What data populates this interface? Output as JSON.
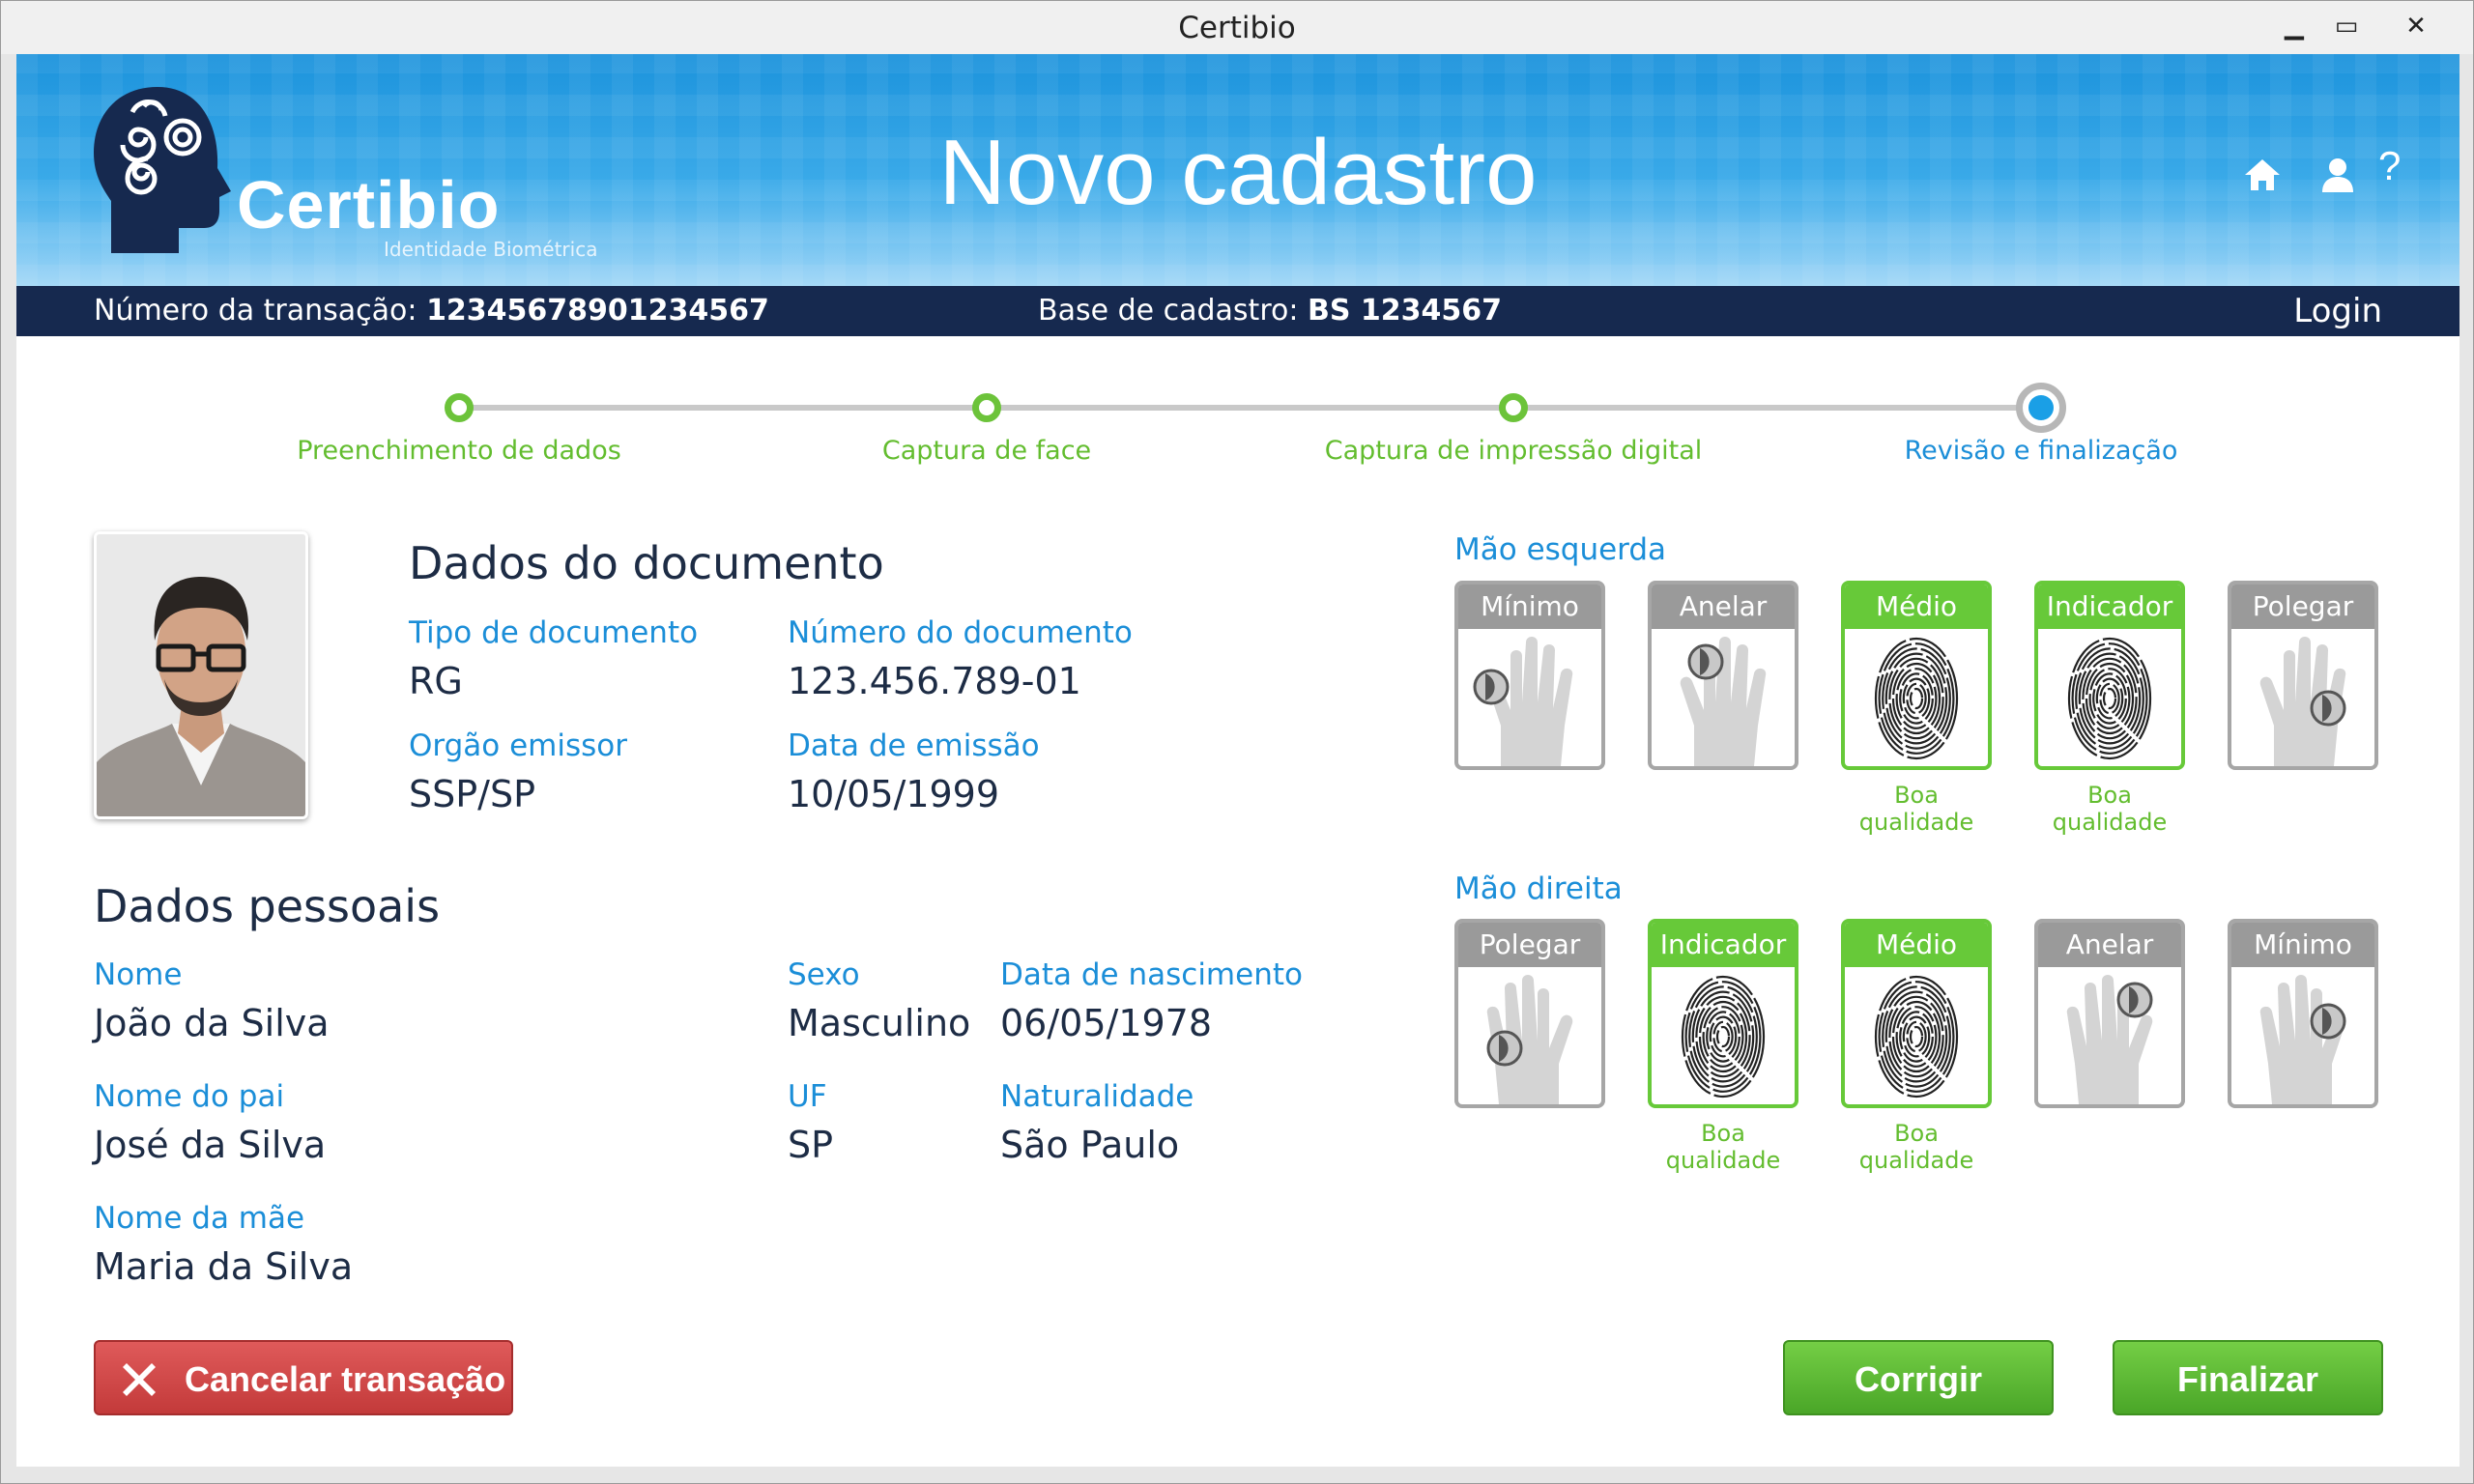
{
  "window": {
    "title": "Certibio",
    "controls": {
      "minimize": "▁",
      "maximize": "▭",
      "close": "✕"
    }
  },
  "header": {
    "brand_name": "Certibio",
    "brand_subtitle": "Identidade Biométrica",
    "page_title": "Novo cadastro",
    "icons": [
      "home-icon",
      "user-icon",
      "help-icon"
    ],
    "help_glyph": "?"
  },
  "infobar": {
    "transaction_label": "Número da transação:",
    "transaction_value": "12345678901234567",
    "base_label": "Base de cadastro:",
    "base_value": "BS 1234567",
    "login": "Login"
  },
  "steps": [
    {
      "label": "Preenchimento de dados",
      "state": "complete"
    },
    {
      "label": "Captura de face",
      "state": "complete"
    },
    {
      "label": "Captura de impressão digital",
      "state": "complete"
    },
    {
      "label": "Revisão e finalização",
      "state": "current"
    }
  ],
  "document": {
    "heading": "Dados do documento",
    "type_label": "Tipo de documento",
    "type_value": "RG",
    "number_label": "Número do documento",
    "number_value": "123.456.789-01",
    "issuer_label": "Orgão emissor",
    "issuer_value": "SSP/SP",
    "date_label": "Data de emissão",
    "date_value": "10/05/1999"
  },
  "personal": {
    "heading": "Dados pessoais",
    "name_label": "Nome",
    "name_value": "João da Silva",
    "sex_label": "Sexo",
    "sex_value": "Masculino",
    "birth_label": "Data de nascimento",
    "birth_value": "06/05/1978",
    "father_label": "Nome do pai",
    "father_value": "José da Silva",
    "uf_label": "UF",
    "uf_value": "SP",
    "birthplace_label": "Naturalidade",
    "birthplace_value": "São Paulo",
    "mother_label": "Nome da mãe",
    "mother_value": "Maria da Silva"
  },
  "left_hand": {
    "title": "Mão esquerda",
    "fingers": [
      {
        "name": "Mínimo",
        "captured": false,
        "quality": ""
      },
      {
        "name": "Anelar",
        "captured": false,
        "quality": ""
      },
      {
        "name": "Médio",
        "captured": true,
        "quality": "Boa qualidade"
      },
      {
        "name": "Indicador",
        "captured": true,
        "quality": "Boa qualidade"
      },
      {
        "name": "Polegar",
        "captured": false,
        "quality": ""
      }
    ]
  },
  "right_hand": {
    "title": "Mão direita",
    "fingers": [
      {
        "name": "Polegar",
        "captured": false,
        "quality": ""
      },
      {
        "name": "Indicador",
        "captured": true,
        "quality": "Boa qualidade"
      },
      {
        "name": "Médio",
        "captured": true,
        "quality": "Boa qualidade"
      },
      {
        "name": "Anelar",
        "captured": false,
        "quality": ""
      },
      {
        "name": "Mínimo",
        "captured": false,
        "quality": ""
      }
    ]
  },
  "actions": {
    "cancel": "Cancelar transação",
    "correct": "Corrigir",
    "finish": "Finalizar"
  },
  "colors": {
    "header_blue": "#1c93dc",
    "infobar_navy": "#16294f",
    "accent_blue": "#1b8ed8",
    "success_green": "#67c939",
    "danger_red": "#c33a3a"
  }
}
